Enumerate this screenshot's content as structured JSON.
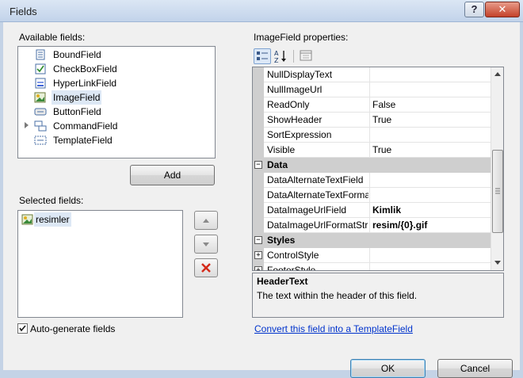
{
  "window": {
    "title": "Fields",
    "help_label": "?",
    "close_label": "✕"
  },
  "available": {
    "label": "Available fields:",
    "items": [
      {
        "label": "BoundField"
      },
      {
        "label": "CheckBoxField"
      },
      {
        "label": "HyperLinkField"
      },
      {
        "label": "ImageField"
      },
      {
        "label": "ButtonField"
      },
      {
        "label": "CommandField"
      },
      {
        "label": "TemplateField"
      }
    ],
    "add_label": "Add"
  },
  "selected": {
    "label": "Selected fields:",
    "items": [
      {
        "label": "resimler"
      }
    ]
  },
  "autogen": {
    "label": "Auto-generate fields",
    "checked": true
  },
  "properties": {
    "label": "ImageField properties:",
    "rows": [
      {
        "name": "NullDisplayText",
        "value": ""
      },
      {
        "name": "NullImageUrl",
        "value": ""
      },
      {
        "name": "ReadOnly",
        "value": "False"
      },
      {
        "name": "ShowHeader",
        "value": "True"
      },
      {
        "name": "SortExpression",
        "value": ""
      },
      {
        "name": "Visible",
        "value": "True"
      }
    ],
    "data_category": "Data",
    "data_rows": [
      {
        "name": "DataAlternateTextField",
        "value": ""
      },
      {
        "name": "DataAlternateTextFormat",
        "value": ""
      },
      {
        "name": "DataImageUrlField",
        "value": "Kimlik"
      },
      {
        "name": "DataImageUrlFormatString",
        "value": "resim/{0}.gif"
      }
    ],
    "styles_category": "Styles",
    "styles_rows": [
      {
        "name": "ControlStyle",
        "value": ""
      },
      {
        "name": "FooterStyle",
        "value": ""
      }
    ]
  },
  "description": {
    "title": "HeaderText",
    "text": "The text within the header of this field."
  },
  "convert_link": "Convert this field into a TemplateField",
  "footer": {
    "ok_label": "OK",
    "cancel_label": "Cancel"
  },
  "colors": {
    "accent_link": "#0033cc",
    "delete_red": "#d42a1a",
    "selection_bg": "#dde8f5",
    "category_bg": "#cfcfcf"
  }
}
